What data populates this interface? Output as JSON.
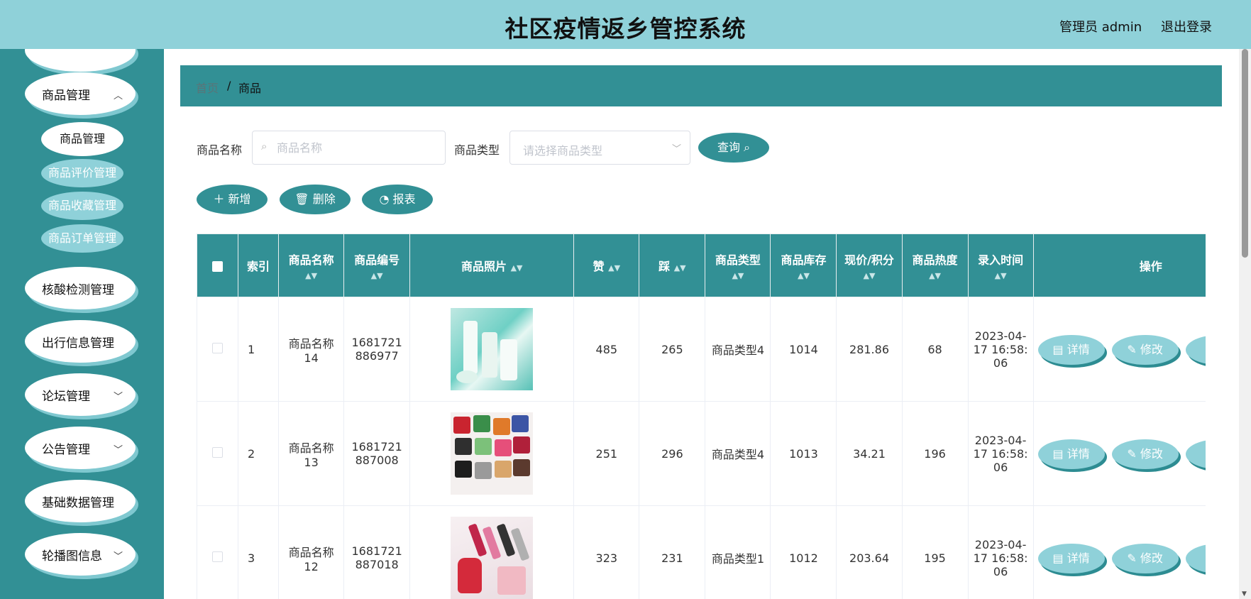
{
  "header": {
    "title": "社区疫情返乡管控系统",
    "user": "管理员 admin",
    "logout": "退出登录"
  },
  "sidebar": {
    "items": [
      {
        "label": "商品管理",
        "expanded": true
      },
      {
        "label": "核酸检测管理"
      },
      {
        "label": "出行信息管理"
      },
      {
        "label": "论坛管理",
        "expanded": false
      },
      {
        "label": "公告管理",
        "expanded": false
      },
      {
        "label": "基础数据管理"
      },
      {
        "label": "轮播图信息",
        "expanded": false
      }
    ],
    "subitems": [
      {
        "label": "商品管理",
        "active": true
      },
      {
        "label": "商品评价管理"
      },
      {
        "label": "商品收藏管理"
      },
      {
        "label": "商品订单管理"
      }
    ]
  },
  "breadcrumb": {
    "home": "首页",
    "separator": "/",
    "current": "商品"
  },
  "search": {
    "name_label": "商品名称",
    "name_placeholder": "商品名称",
    "name_value": "",
    "type_label": "商品类型",
    "type_placeholder": "请选择商品类型",
    "query_button": "查询"
  },
  "toolbar": {
    "add": "新增",
    "delete": "删除",
    "report": "报表"
  },
  "table": {
    "columns": [
      "索引",
      "商品名称",
      "商品编号",
      "商品照片",
      "赞",
      "踩",
      "商品类型",
      "商品库存",
      "现价/积分",
      "商品热度",
      "录入时间",
      "操作"
    ],
    "rows": [
      {
        "index": "1",
        "name": "商品名称14",
        "code": "1681721886977",
        "likes": "485",
        "dislikes": "265",
        "type": "商品类型4",
        "stock": "1014",
        "price": "281.86",
        "heat": "68",
        "time": "2023-04-17 16:58:06"
      },
      {
        "index": "2",
        "name": "商品名称13",
        "code": "1681721887008",
        "likes": "251",
        "dislikes": "296",
        "type": "商品类型4",
        "stock": "1013",
        "price": "34.21",
        "heat": "196",
        "time": "2023-04-17 16:58:06"
      },
      {
        "index": "3",
        "name": "商品名称12",
        "code": "1681721887018",
        "likes": "323",
        "dislikes": "231",
        "type": "商品类型1",
        "stock": "1012",
        "price": "203.64",
        "heat": "195",
        "time": "2023-04-17 16:58:06"
      }
    ],
    "actions": {
      "detail": "详情",
      "edit": "修改"
    }
  },
  "colors": {
    "header_bg": "#8fd1d9",
    "primary": "#329095",
    "light": "#8fd1d9"
  }
}
